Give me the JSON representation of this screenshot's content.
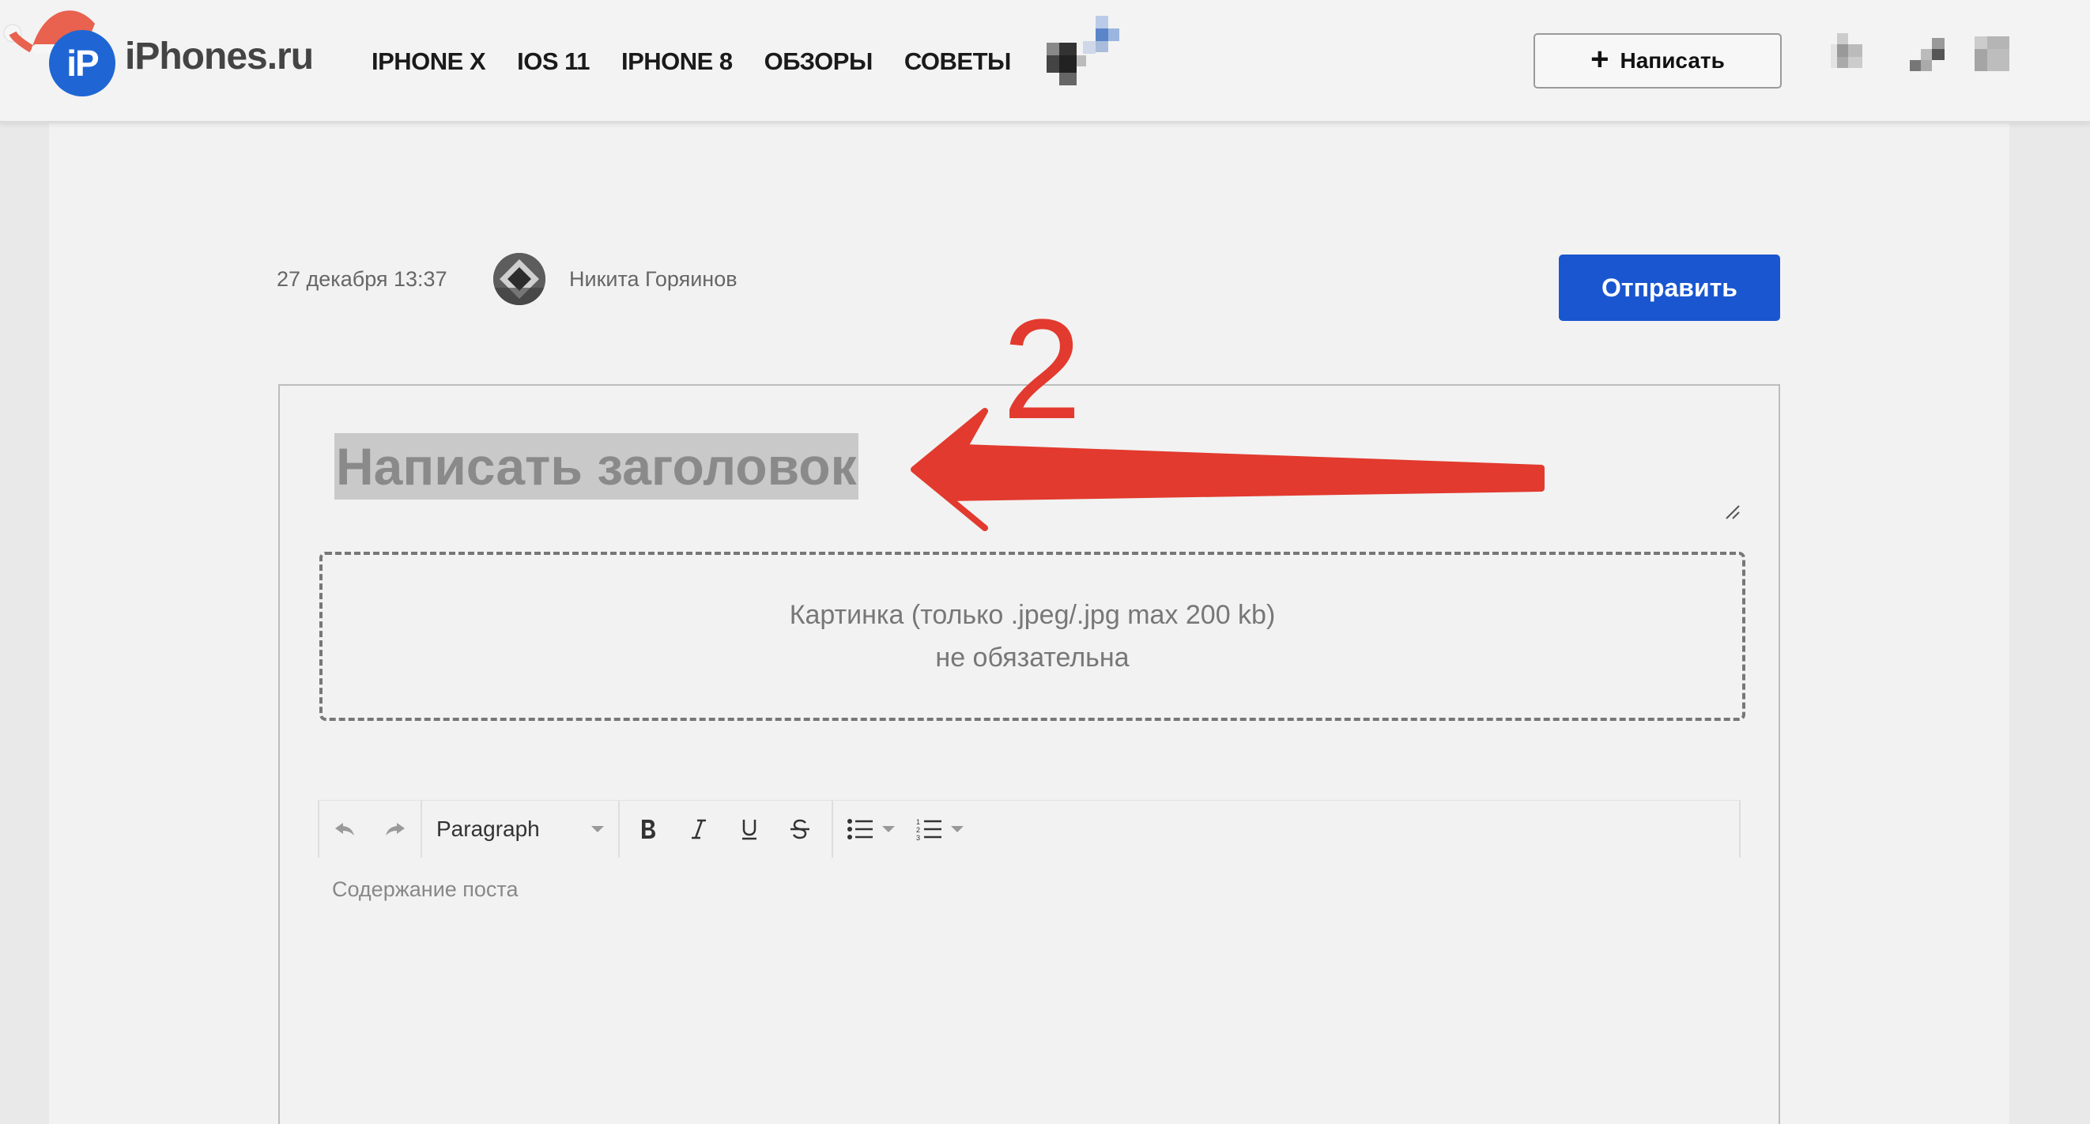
{
  "header": {
    "logo_mark": "iP",
    "logo_text": "iPhones.ru",
    "nav": [
      "IPHONE X",
      "IOS 11",
      "IPHONE 8",
      "ОБЗОРЫ",
      "СОВЕТЫ"
    ],
    "write_button": "Написать"
  },
  "post": {
    "date": "27 декабря 13:37",
    "author": "Никита Горяинов",
    "send_button": "Отправить",
    "title_placeholder": "Написать заголовок",
    "image_line1": "Картинка (только .jpeg/.jpg max 200 kb)",
    "image_line2": "не обязательна",
    "block_format": "Paragraph",
    "content_placeholder": "Содержание поста"
  },
  "annotation": {
    "number": "2",
    "color": "#e23a2e"
  },
  "colors": {
    "brand_blue": "#1f66d4",
    "send_blue": "#1a56cf"
  }
}
